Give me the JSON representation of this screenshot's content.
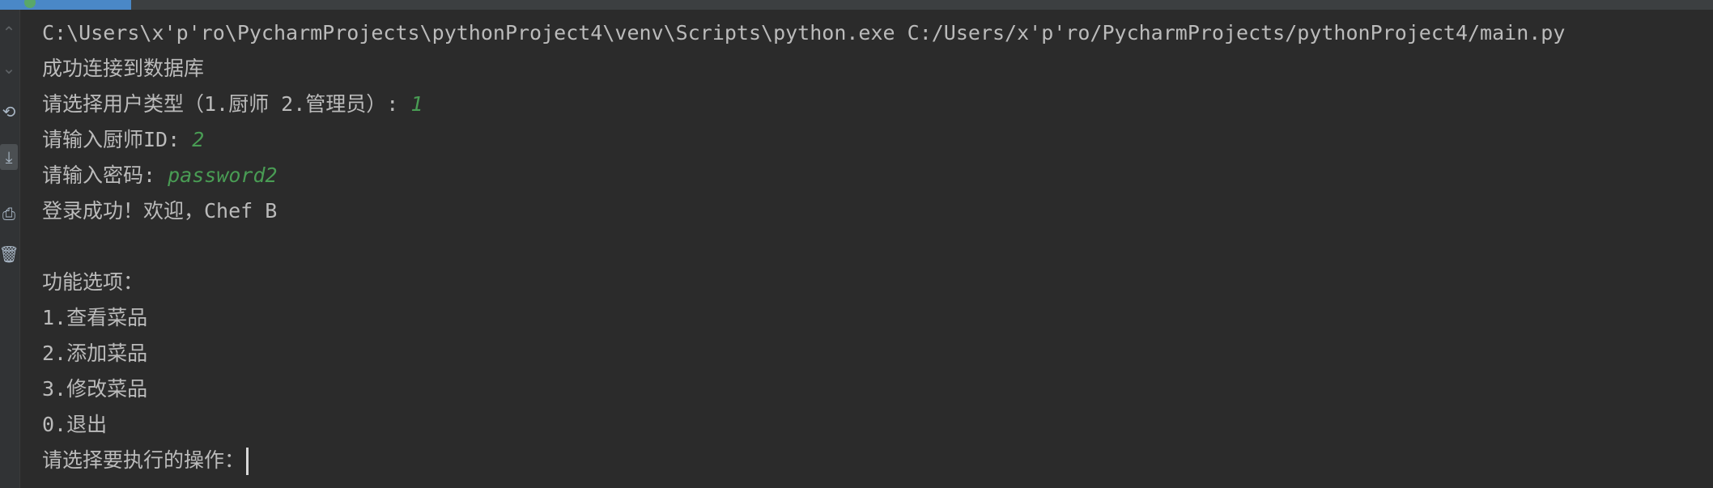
{
  "toolbar": {
    "icons": [
      "up-arrow-icon",
      "down-arrow-icon",
      "rerun-icon",
      "scroll-to-end-icon",
      "print-icon",
      "trash-icon"
    ]
  },
  "console": {
    "lines": [
      {
        "text": "C:\\Users\\x'p'ro\\PycharmProjects\\pythonProject4\\venv\\Scripts\\python.exe C:/Users/x'p'ro/PycharmProjects/pythonProject4/main.py",
        "input": ""
      },
      {
        "text": "成功连接到数据库",
        "input": ""
      },
      {
        "text": "请选择用户类型（1.厨师 2.管理员）: ",
        "input": "1"
      },
      {
        "text": "请输入厨师ID: ",
        "input": "2"
      },
      {
        "text": "请输入密码: ",
        "input": "password2"
      },
      {
        "text": "登录成功！欢迎，Chef B",
        "input": ""
      },
      {
        "text": "",
        "input": ""
      },
      {
        "text": "功能选项：",
        "input": ""
      },
      {
        "text": "1.查看菜品",
        "input": ""
      },
      {
        "text": "2.添加菜品",
        "input": ""
      },
      {
        "text": "3.修改菜品",
        "input": ""
      },
      {
        "text": "0.退出",
        "input": ""
      },
      {
        "text": "请选择要执行的操作：",
        "input": ""
      }
    ]
  },
  "colors": {
    "background": "#2b2b2b",
    "text": "#bbbbbb",
    "user_input": "#499c54",
    "gutter": "#313335",
    "accent": "#4a88c7"
  }
}
